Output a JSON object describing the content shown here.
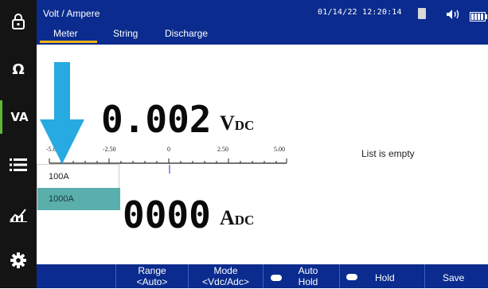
{
  "header": {
    "title": "Volt / Ampere",
    "datetime": "01/14/22  12:20:14"
  },
  "tabs": [
    {
      "label": "Meter"
    },
    {
      "label": "String"
    },
    {
      "label": "Discharge"
    }
  ],
  "sidebar": {
    "items": [
      {
        "label": "",
        "icon": "lock-icon"
      },
      {
        "label": "Ω",
        "icon": "ohm-icon"
      },
      {
        "label": "VA",
        "icon": "volt-ampere"
      },
      {
        "label": "",
        "icon": "list-icon"
      },
      {
        "label": "",
        "icon": "chart-icon"
      },
      {
        "label": "",
        "icon": "gear-icon"
      }
    ],
    "active_item": "VA"
  },
  "readings": {
    "primary_value": "0.002",
    "primary_unit_main": "V",
    "primary_unit_sub": "DC",
    "secondary_value": "0000",
    "secondary_unit_main": "A",
    "secondary_unit_sub": "DC"
  },
  "scale": {
    "tick_labels": [
      "-5.00",
      "-2.50",
      "0",
      "2.50",
      "5.00"
    ]
  },
  "list_panel": {
    "empty_text": "List is empty"
  },
  "dropdown": {
    "options": [
      "100A",
      "1000A"
    ],
    "selected": "1000A"
  },
  "softkeys": {
    "range_label": "Range",
    "range_value": "<Auto>",
    "mode_label": "Mode",
    "mode_value": "<Vdc/Adc>",
    "auto_hold_label": "Auto Hold",
    "hold_label": "Hold",
    "save_label": "Save"
  },
  "colors": {
    "header_bg": "#0b2c8e",
    "tab_underline": "#f2b218",
    "sidebar_bg": "#141414",
    "active_indicator": "#5fb832",
    "arrow": "#27a9e1",
    "dropdown_selected": "#5aaeac"
  }
}
